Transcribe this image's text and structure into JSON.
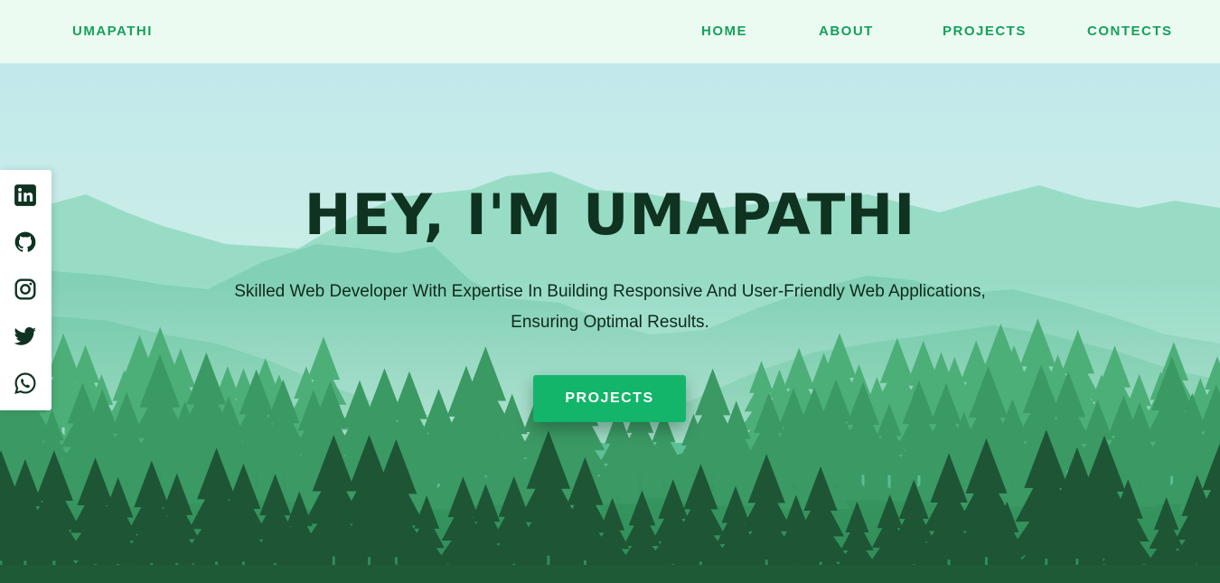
{
  "nav": {
    "brand": "UMAPATHI",
    "links": [
      {
        "label": "HOME"
      },
      {
        "label": "ABOUT"
      },
      {
        "label": "PROJECTS"
      },
      {
        "label": "CONTECTS"
      }
    ]
  },
  "hero": {
    "title": "HEY, I'M UMAPATHI",
    "subtitle": "Skilled Web Developer With Expertise In Building Responsive And User-Friendly Web Applications, Ensuring Optimal Results.",
    "button_label": "PROJECTS"
  },
  "social": {
    "icons": [
      "linkedin-icon",
      "github-icon",
      "instagram-icon",
      "twitter-icon",
      "whatsapp-icon"
    ]
  },
  "colors": {
    "accent": "#17a05a",
    "button": "#13b56a",
    "nav_background": "#ebfbf2",
    "title": "#0f3320"
  }
}
